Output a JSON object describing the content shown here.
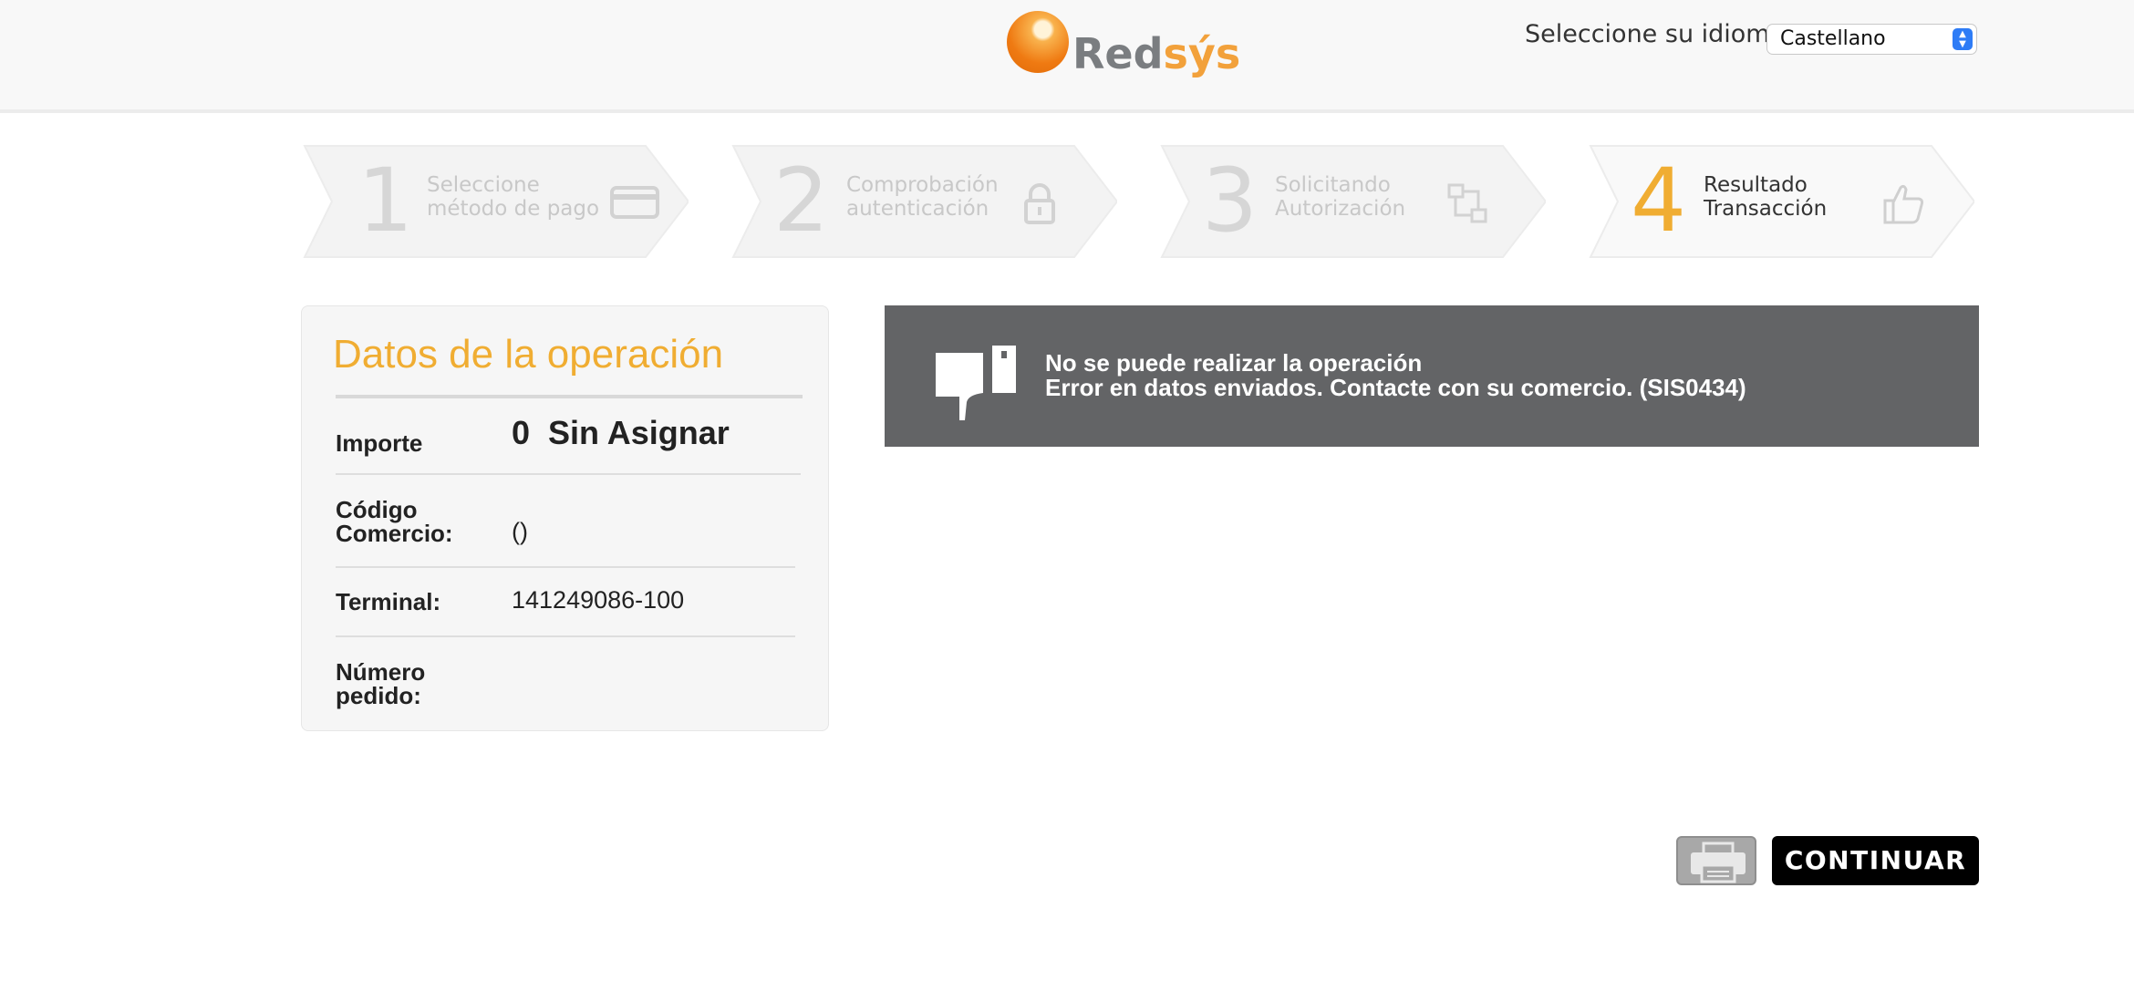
{
  "header": {
    "logo_text_part1": "Red",
    "logo_text_part2": "sýs",
    "language_label": "Seleccione su idioma",
    "language_selected": "Castellano"
  },
  "steps": [
    {
      "number": "1",
      "line1": "Seleccione",
      "line2": "método de pago",
      "icon": "credit-card-icon",
      "active": false
    },
    {
      "number": "2",
      "line1": "Comprobación",
      "line2": "autenticación",
      "icon": "lock-icon",
      "active": false
    },
    {
      "number": "3",
      "line1": "Solicitando",
      "line2": "Autorización",
      "icon": "network-icon",
      "active": false
    },
    {
      "number": "4",
      "line1": "Resultado",
      "line2": "Transacción",
      "icon": "thumbs-up-icon",
      "active": true
    }
  ],
  "operation": {
    "title": "Datos de la operación",
    "importe_label": "Importe",
    "importe_value": "0  Sin Asignar",
    "codigo_label_1": "Código",
    "codigo_label_2": "Comercio:",
    "codigo_value": "()",
    "terminal_label": "Terminal:",
    "terminal_value": "141249086-100",
    "pedido_label_1": "Número",
    "pedido_label_2": "pedido:",
    "pedido_value": ""
  },
  "error": {
    "line1": "No se puede realizar la operación",
    "line2": "Error en datos enviados. Contacte con su comercio. (SIS0434)"
  },
  "actions": {
    "continue_label": "CONTINUAR",
    "print_icon": "printer-icon"
  },
  "colors": {
    "accent": "#f0ad32",
    "error_bg": "#636466",
    "inactive_step": "#d6d6d6"
  }
}
